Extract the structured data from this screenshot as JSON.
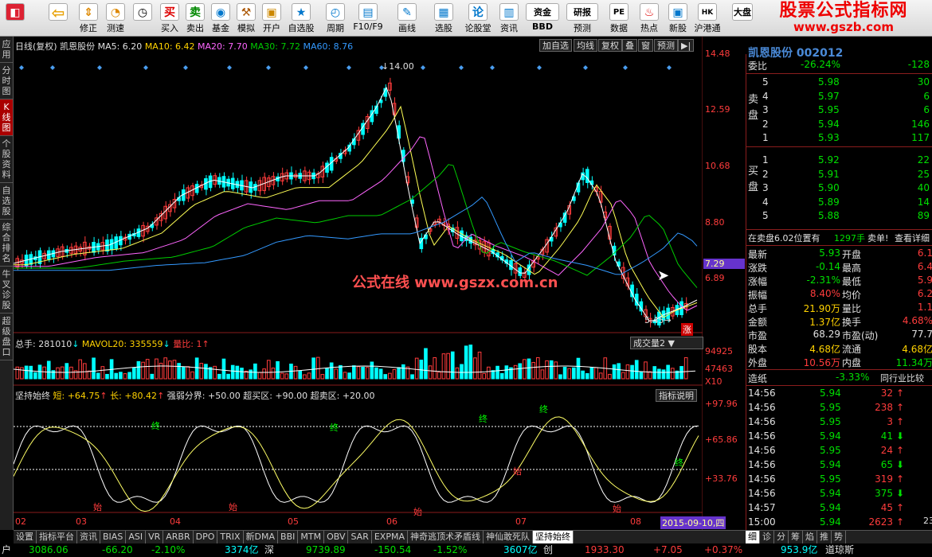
{
  "toolbar": {
    "buttons": [
      {
        "label": "",
        "icon": "back-icon"
      },
      {
        "label": "修正",
        "icon": "arrow-up-down-icon"
      },
      {
        "label": "测速",
        "icon": "speed-icon"
      },
      {
        "label": "",
        "icon": "clock-icon"
      },
      {
        "label": "买入",
        "icon": "buy-icon"
      },
      {
        "label": "卖出",
        "icon": "sell-icon"
      },
      {
        "label": "基金",
        "icon": "fund-icon"
      },
      {
        "label": "模拟",
        "icon": "hammer-icon"
      },
      {
        "label": "开户",
        "icon": "lock-icon"
      },
      {
        "label": "自选股",
        "icon": "star-icon"
      },
      {
        "label": "周期",
        "icon": "cycle-icon"
      },
      {
        "label": "F10/F9",
        "icon": "f10-icon"
      },
      {
        "label": "画线",
        "icon": "pencil-icon"
      },
      {
        "label": "选股",
        "icon": "screen-icon"
      },
      {
        "label": "论股堂",
        "icon": "chat-icon"
      },
      {
        "label": "资讯",
        "icon": "news-icon"
      },
      {
        "label": "资金",
        "icon": "money-icon"
      },
      {
        "label": "研报",
        "icon": "report-icon"
      },
      {
        "label": "数据",
        "icon": "pe-icon"
      },
      {
        "label": "热点",
        "icon": "hot-icon"
      },
      {
        "label": "新股",
        "icon": "ipo-icon"
      },
      {
        "label": "沪港通",
        "icon": "hk-icon"
      },
      {
        "label": "大盘",
        "icon": "market-icon"
      }
    ],
    "extra": {
      "bbd": "BBD",
      "yuce": "预测"
    }
  },
  "brand": {
    "title": "股票公式指标网",
    "url": "www.gszb.com"
  },
  "sidebar": {
    "items": [
      "应用",
      "分时图",
      "K线图",
      "个股资料",
      "自选股",
      "综合排名",
      "牛叉诊股",
      "超级盘口"
    ],
    "active": 2
  },
  "chart": {
    "header": {
      "period": "日线(复权)",
      "stock": "凯恩股份",
      "ma5": "MA5: 6.20",
      "ma10": "MA10: 6.42",
      "ma20": "MA20: 7.70",
      "ma30": "MA30: 7.72",
      "ma60": "MA60: 8.76"
    },
    "buttons": [
      "加自选",
      "均线",
      "复权",
      "叠",
      "窗",
      "预测"
    ],
    "price_ticks": [
      "14.48",
      "12.59",
      "10.68",
      "8.80",
      "6.89"
    ],
    "current_price": "7.29",
    "high_label": "14.00",
    "low_label": "5.45",
    "zhang": "涨",
    "watermark": "公式在线  www.gszx.com.cn",
    "volume": {
      "total": "总手: 281010",
      "mavol": "MAVOL20: 335559",
      "liangbi": "量比: 1",
      "dropdown": "成交量2 ▼",
      "ticks": [
        "94925",
        "47463",
        "X10"
      ]
    },
    "indicator": {
      "name": "坚持始终",
      "short": "短: +64.75",
      "long": "长: +80.42",
      "strong": "强弱分界: +50.00",
      "overbuy": "超买区: +90.00",
      "oversell": "超卖区: +20.00",
      "help": "指标说明",
      "ticks": [
        "+97.96",
        "+65.86",
        "+33.76"
      ],
      "mark_start": "始",
      "mark_end": "终"
    },
    "x_axis": [
      "02",
      "03",
      "04",
      "05",
      "06",
      "07",
      "08",
      "09"
    ],
    "date_badge": "2015-09-10,四",
    "colors": {
      "up": "#ff3c3c",
      "down": "#00ffff",
      "ma5": "#ffffff",
      "ma10": "#ffff55",
      "ma20": "#ff66ff",
      "ma30": "#00cc00",
      "ma60": "#3399ff"
    }
  },
  "chart_data": {
    "type": "candlestick",
    "title": "凯恩股份 日线(复权)",
    "ylim": [
      5.45,
      14.48
    ],
    "high": 14.0,
    "low": 5.45,
    "close": 7.29,
    "x_ticks": [
      "02",
      "03",
      "04",
      "05",
      "06",
      "07",
      "08",
      "09"
    ]
  },
  "quote": {
    "header": {
      "label": "委比",
      "ratio": "-26.24%",
      "diff": "-128",
      "stock_banner": "凯恩股份 002012"
    },
    "sell_label": "卖盘",
    "buy_label": "买盘",
    "sell": [
      {
        "n": "5",
        "p": "5.98",
        "v": "30"
      },
      {
        "n": "4",
        "p": "5.97",
        "v": "6"
      },
      {
        "n": "3",
        "p": "5.95",
        "v": "6"
      },
      {
        "n": "2",
        "p": "5.94",
        "v": "146"
      },
      {
        "n": "1",
        "p": "5.93",
        "v": "117"
      }
    ],
    "buy": [
      {
        "n": "1",
        "p": "5.92",
        "v": "22"
      },
      {
        "n": "2",
        "p": "5.91",
        "v": "25"
      },
      {
        "n": "3",
        "p": "5.90",
        "v": "40"
      },
      {
        "n": "4",
        "p": "5.89",
        "v": "14"
      },
      {
        "n": "5",
        "p": "5.88",
        "v": "89"
      }
    ],
    "info_line": {
      "text": "在卖盘6.02位置有",
      "qty": "1297手",
      "sell": "卖单!",
      "detail": "查看详细"
    },
    "stats": [
      {
        "k": "最新",
        "v": "5.93",
        "k2": "开盘",
        "v2": "6.1"
      },
      {
        "k": "涨跌",
        "v": "-0.14",
        "k2": "最高",
        "v2": "6.4"
      },
      {
        "k": "涨幅",
        "v": "-2.31%",
        "k2": "最低",
        "v2": "5.9"
      },
      {
        "k": "振幅",
        "v": "8.40%",
        "k2": "均价",
        "v2": "6.2"
      },
      {
        "k": "总手",
        "v": "21.90万",
        "k2": "量比",
        "v2": "1.1"
      },
      {
        "k": "金额",
        "v": "1.37亿",
        "k2": "换手",
        "v2": "4.68%"
      },
      {
        "k": "市盈",
        "v": "68.29",
        "k2": "市盈(动)",
        "v2": "77.7"
      },
      {
        "k": "股本",
        "v": "4.68亿",
        "k2": "流通",
        "v2": "4.68亿"
      },
      {
        "k": "外盘",
        "v": "10.56万",
        "k2": "内盘",
        "v2": "11.34万"
      }
    ],
    "industry": {
      "name": "造纸",
      "change": "-3.33%",
      "compare": "同行业比较"
    },
    "ticks": [
      {
        "t": "14:56",
        "p": "5.94",
        "v": "32",
        "d": "up"
      },
      {
        "t": "14:56",
        "p": "5.95",
        "v": "238",
        "d": "up"
      },
      {
        "t": "14:56",
        "p": "5.95",
        "v": "3",
        "d": "up"
      },
      {
        "t": "14:56",
        "p": "5.94",
        "v": "41",
        "d": "down"
      },
      {
        "t": "14:56",
        "p": "5.95",
        "v": "24",
        "d": "up"
      },
      {
        "t": "14:56",
        "p": "5.94",
        "v": "65",
        "d": "down"
      },
      {
        "t": "14:56",
        "p": "5.95",
        "v": "319",
        "d": "up"
      },
      {
        "t": "14:56",
        "p": "5.94",
        "v": "375",
        "d": "down"
      },
      {
        "t": "14:57",
        "p": "5.94",
        "v": "45",
        "d": "up"
      },
      {
        "t": "15:00",
        "p": "5.94",
        "v": "2623",
        "d": "up"
      }
    ],
    "tick_extra": "23"
  },
  "tabs": {
    "items": [
      "设置",
      "指标平台",
      "资讯",
      "BIAS",
      "ASI",
      "VR",
      "ARBR",
      "DPO",
      "TRIX",
      "新DMA",
      "BBI",
      "MTM",
      "OBV",
      "SAR",
      "EXPMA",
      "神奇逃顶术矛盾线",
      "神仙敢死队",
      "坚持始终"
    ],
    "active": 17
  },
  "rtabs": [
    "细",
    "诊",
    "分",
    "筹",
    "焰",
    "推",
    "势"
  ],
  "status": {
    "sh": "户",
    "sh_index": "3086.06",
    "sh_chg": "-66.20",
    "sh_pct": "-2.10%",
    "sh_amt": "3374亿",
    "sz_name": "深",
    "sz_index": "9739.89",
    "sz_chg": "-150.54",
    "sz_pct": "-1.52%",
    "sz_amt": "3607亿",
    "cy_name": "创",
    "cy_index": "1933.30",
    "cy_chg": "+7.05",
    "cy_pct": "+0.37%",
    "dj_amt": "953.9亿",
    "dj_name": "道琼斯"
  }
}
